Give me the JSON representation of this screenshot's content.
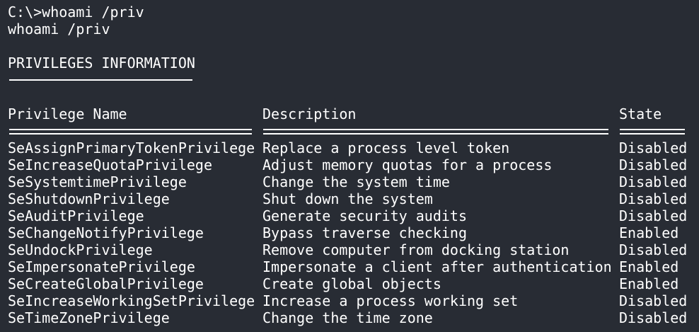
{
  "terminal": {
    "prompt_line": "C:\\>whoami /priv",
    "echo_line": "whoami /priv",
    "section_title": "PRIVILEGES INFORMATION",
    "headers": {
      "name": "Privilege Name",
      "description": "Description",
      "state": "State"
    },
    "rows": [
      {
        "name": "SeAssignPrimaryTokenPrivilege",
        "description": "Replace a process level token",
        "state": "Disabled"
      },
      {
        "name": "SeIncreaseQuotaPrivilege",
        "description": "Adjust memory quotas for a process",
        "state": "Disabled"
      },
      {
        "name": "SeSystemtimePrivilege",
        "description": "Change the system time",
        "state": "Disabled"
      },
      {
        "name": "SeShutdownPrivilege",
        "description": "Shut down the system",
        "state": "Disabled"
      },
      {
        "name": "SeAuditPrivilege",
        "description": "Generate security audits",
        "state": "Disabled"
      },
      {
        "name": "SeChangeNotifyPrivilege",
        "description": "Bypass traverse checking",
        "state": "Enabled"
      },
      {
        "name": "SeUndockPrivilege",
        "description": "Remove computer from docking station",
        "state": "Disabled"
      },
      {
        "name": "SeImpersonatePrivilege",
        "description": "Impersonate a client after authentication",
        "state": "Enabled"
      },
      {
        "name": "SeCreateGlobalPrivilege",
        "description": "Create global objects",
        "state": "Enabled"
      },
      {
        "name": "SeIncreaseWorkingSetPrivilege",
        "description": "Increase a process working set",
        "state": "Disabled"
      },
      {
        "name": "SeTimeZonePrivilege",
        "description": "Change the time zone",
        "state": "Disabled"
      }
    ]
  },
  "colors": {
    "background": "#282c34",
    "text": "#ffffff"
  }
}
